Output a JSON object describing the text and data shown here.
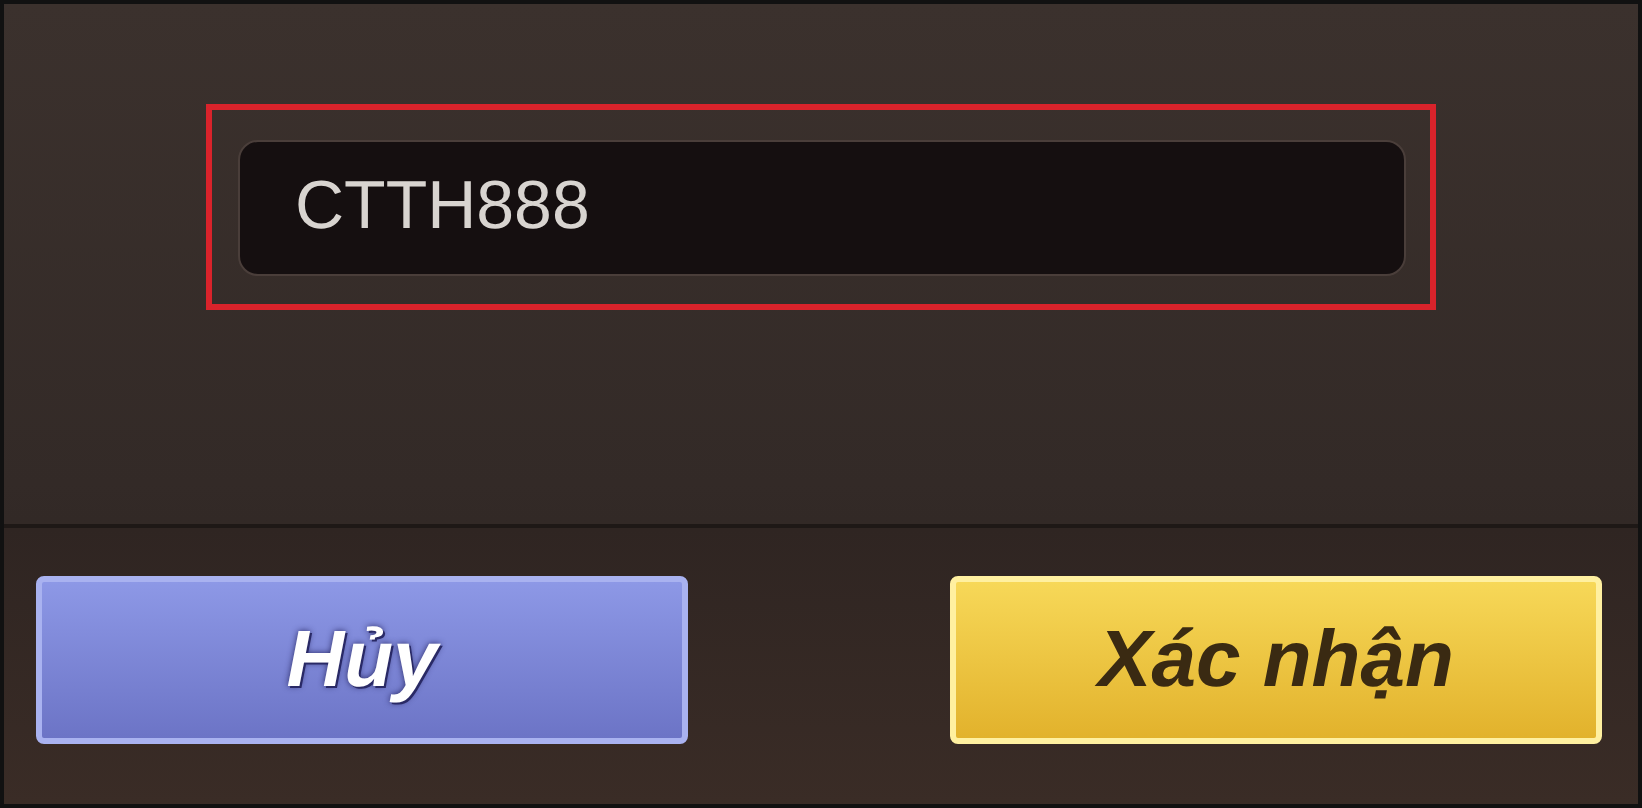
{
  "code_input": {
    "value": "CTTH888",
    "highlighted": true
  },
  "buttons": [
    {
      "kind": "cancel",
      "label": "Hủy"
    },
    {
      "kind": "confirm",
      "label": "Xác nhận"
    }
  ]
}
